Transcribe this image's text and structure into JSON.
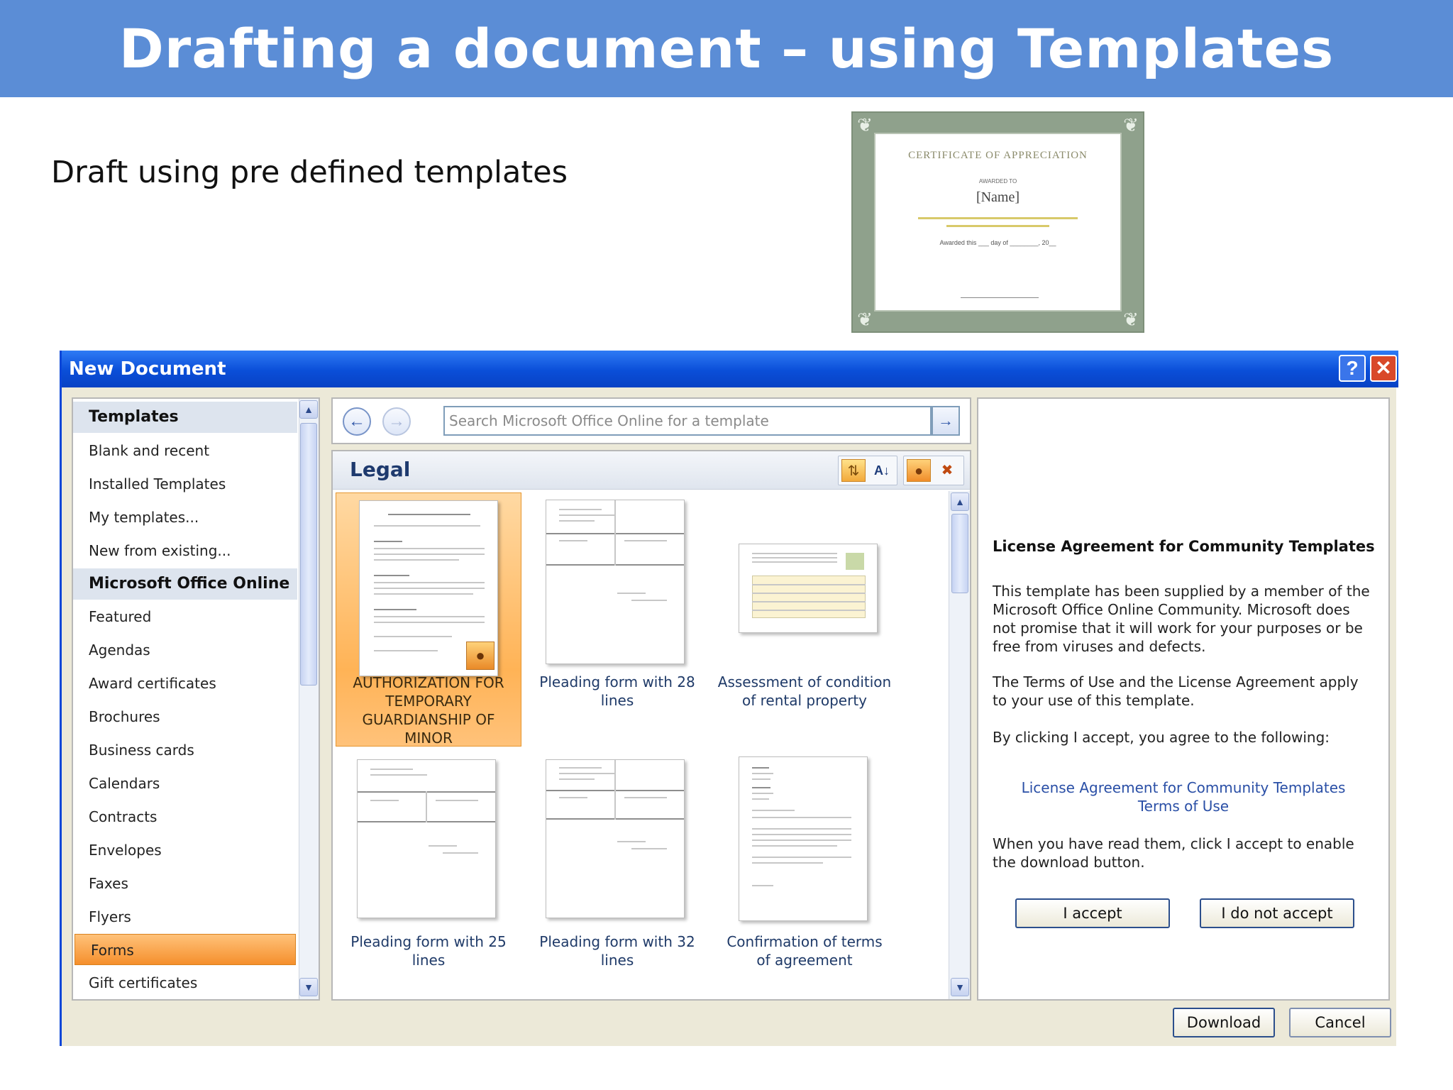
{
  "slide": {
    "title": "Drafting a document – using Templates",
    "subtitle": "Draft using pre defined templates"
  },
  "certificate": {
    "title": "CERTIFICATE OF APPRECIATION",
    "awarded_to": "AWARDED TO",
    "name": "[Name]",
    "date_line": "Awarded this ___ day of ________, 20__"
  },
  "dialog": {
    "title": "New Document",
    "help_icon": "?",
    "close_icon": "✕",
    "left_nav": {
      "items": [
        {
          "label": "Templates",
          "kind": "header"
        },
        {
          "label": "Blank and recent",
          "kind": "item"
        },
        {
          "label": "Installed Templates",
          "kind": "item"
        },
        {
          "label": "My templates...",
          "kind": "item"
        },
        {
          "label": "New from existing...",
          "kind": "item"
        },
        {
          "label": "Microsoft Office Online",
          "kind": "header"
        },
        {
          "label": "Featured",
          "kind": "item"
        },
        {
          "label": "Agendas",
          "kind": "item"
        },
        {
          "label": "Award certificates",
          "kind": "item"
        },
        {
          "label": "Brochures",
          "kind": "item"
        },
        {
          "label": "Business cards",
          "kind": "item"
        },
        {
          "label": "Calendars",
          "kind": "item"
        },
        {
          "label": "Contracts",
          "kind": "item"
        },
        {
          "label": "Envelopes",
          "kind": "item"
        },
        {
          "label": "Faxes",
          "kind": "item"
        },
        {
          "label": "Flyers",
          "kind": "item"
        },
        {
          "label": "Forms",
          "kind": "selected"
        },
        {
          "label": "Gift certificates",
          "kind": "item"
        }
      ]
    },
    "search": {
      "placeholder": "Search Microsoft Office Online for a template",
      "back_icon": "arrow-left-icon",
      "forward_icon": "arrow-right-icon",
      "go_icon": "arrow-right-icon"
    },
    "gallery": {
      "category": "Legal",
      "templates": [
        {
          "label_lines": [
            "AUTHORIZATION FOR",
            "TEMPORARY",
            "GUARDIANSHIP OF",
            "MINOR"
          ],
          "selected": true
        },
        {
          "label_lines": [
            "Pleading form with 28",
            "lines"
          ],
          "selected": false
        },
        {
          "label_lines": [
            "Assessment of condition",
            "of rental property"
          ],
          "selected": false
        },
        {
          "label_lines": [
            "Pleading form with 25",
            "lines"
          ],
          "selected": false
        },
        {
          "label_lines": [
            "Pleading form with 32",
            "lines"
          ],
          "selected": false
        },
        {
          "label_lines": [
            "Confirmation of terms",
            "of agreement"
          ],
          "selected": false
        }
      ]
    },
    "license": {
      "title": "License Agreement for Community Templates",
      "para1": "This template has been supplied by a member of the Microsoft Office Online Community. Microsoft does not promise that it will work for your purposes or be free from viruses and defects.",
      "para2": "The Terms of Use and the License Agreement apply to your use of this template.",
      "para3": "By clicking I accept, you agree to the following:",
      "link1": "License Agreement for Community Templates",
      "link2": "Terms of Use",
      "para4": "When you have read them, click I accept to enable the download button.",
      "accept_label": "I accept",
      "decline_label": "I do not accept"
    },
    "footer": {
      "download_label": "Download",
      "cancel_label": "Cancel"
    }
  },
  "colors": {
    "header_blue": "#5b8dd6",
    "titlebar_blue": "#0a4ed8",
    "selection_orange": "#f58f2c",
    "link_blue": "#2a4fa6"
  }
}
